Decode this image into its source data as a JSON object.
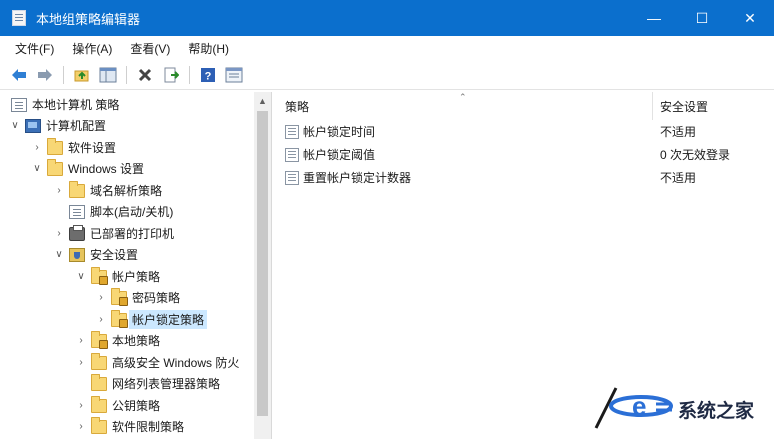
{
  "window": {
    "title": "本地组策略编辑器",
    "controls": {
      "minimize": "—",
      "maximize": "☐",
      "close": "✕"
    }
  },
  "menu": {
    "items": [
      "文件(F)",
      "操作(A)",
      "查看(V)",
      "帮助(H)"
    ]
  },
  "toolbar": {
    "buttons": [
      "back-icon",
      "forward-icon",
      "up-folder-icon",
      "show-hide-tree-icon",
      "delete-icon",
      "export-list-icon",
      "help-icon",
      "properties-icon"
    ]
  },
  "tree": {
    "items": [
      {
        "label": "本地计算机 策略",
        "icon": "policy-root-icon",
        "chevron": ""
      },
      {
        "label": "计算机配置",
        "icon": "computer-icon",
        "chevron": "expanded"
      },
      {
        "label": "软件设置",
        "icon": "folder-icon",
        "chevron": "collapsed"
      },
      {
        "label": "Windows 设置",
        "icon": "folder-icon",
        "chevron": "expanded"
      },
      {
        "label": "域名解析策略",
        "icon": "folder-icon",
        "chevron": "collapsed"
      },
      {
        "label": "脚本(启动/关机)",
        "icon": "script-icon",
        "chevron": ""
      },
      {
        "label": "已部署的打印机",
        "icon": "printer-icon",
        "chevron": "collapsed"
      },
      {
        "label": "安全设置",
        "icon": "security-icon",
        "chevron": "expanded"
      },
      {
        "label": "帐户策略",
        "icon": "lock-folder-icon",
        "chevron": "expanded"
      },
      {
        "label": "密码策略",
        "icon": "lock-folder-icon",
        "chevron": "collapsed"
      },
      {
        "label": "帐户锁定策略",
        "icon": "lock-folder-icon",
        "chevron": "collapsed",
        "selected": true
      },
      {
        "label": "本地策略",
        "icon": "lock-folder-icon",
        "chevron": "collapsed"
      },
      {
        "label": "高级安全 Windows 防火",
        "icon": "folder-icon",
        "chevron": "collapsed"
      },
      {
        "label": "网络列表管理器策略",
        "icon": "folder-icon",
        "chevron": ""
      },
      {
        "label": "公钥策略",
        "icon": "folder-icon",
        "chevron": "collapsed"
      },
      {
        "label": "软件限制策略",
        "icon": "folder-icon",
        "chevron": "collapsed"
      }
    ]
  },
  "list": {
    "columns": {
      "policy": "策略",
      "setting": "安全设置"
    },
    "rows": [
      {
        "policy": "帐户锁定时间",
        "setting": "不适用"
      },
      {
        "policy": "帐户锁定阈值",
        "setting": "0 次无效登录"
      },
      {
        "policy": "重置帐户锁定计数器",
        "setting": "不适用"
      }
    ]
  },
  "watermark": {
    "text": "系统之家"
  },
  "colors": {
    "titlebar": "#0b6fcd",
    "selection": "#cce8ff"
  }
}
